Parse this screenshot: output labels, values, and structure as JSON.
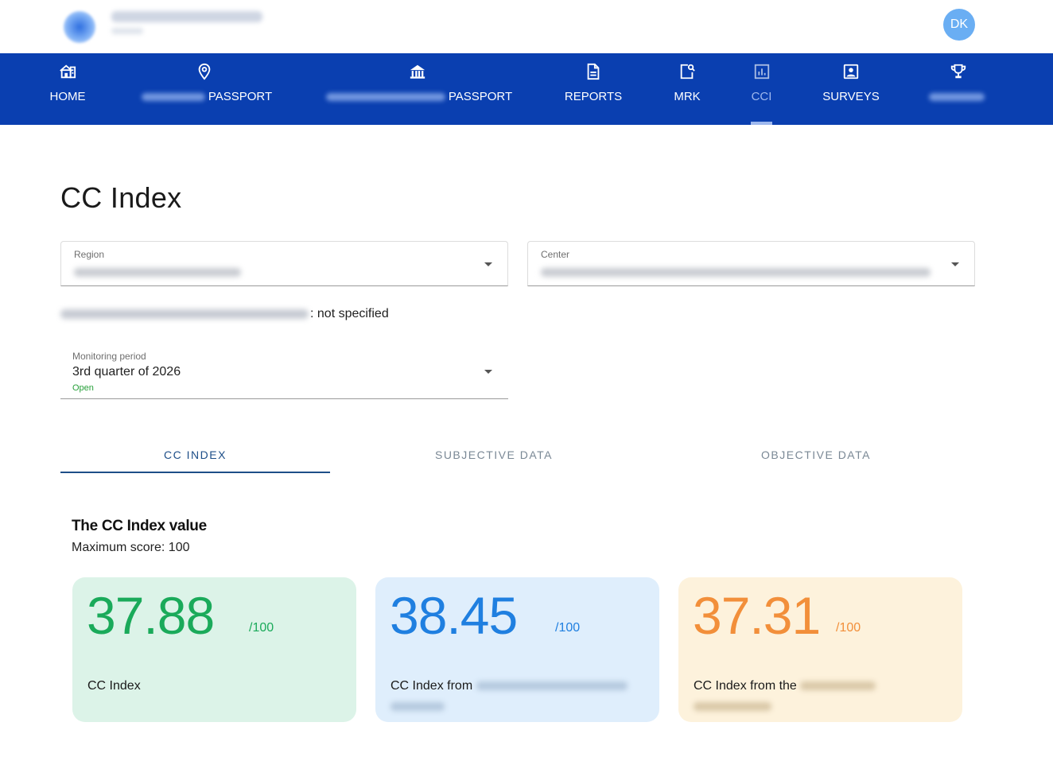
{
  "header": {
    "avatar_initials": "DK"
  },
  "nav": {
    "items": [
      {
        "label": "HOME",
        "icon": "home-building-icon"
      },
      {
        "label": "PASSPORT",
        "icon": "map-pin-icon"
      },
      {
        "label": "PASSPORT",
        "icon": "institution-icon"
      },
      {
        "label": "REPORTS",
        "icon": "document-icon"
      },
      {
        "label": "MRK",
        "icon": "document-search-icon"
      },
      {
        "label": "CCI",
        "icon": "bar-chart-icon",
        "active": true
      },
      {
        "label": "SURVEYS",
        "icon": "survey-person-icon"
      },
      {
        "label": "",
        "icon": "trophy-icon"
      }
    ],
    "active_color": "#9eb8ee",
    "background_color": "#0a3fb0"
  },
  "page": {
    "title": "CC Index"
  },
  "filters": {
    "region_label": "Region",
    "center_label": "Center",
    "wave_value": ": not specified",
    "period_label": "Monitoring period",
    "period_value": "3rd quarter of 2026",
    "period_status": "Open"
  },
  "tabs": [
    {
      "label": "CC INDEX",
      "active": true
    },
    {
      "label": "SUBJECTIVE DATA"
    },
    {
      "label": "OBJECTIVE DATA"
    }
  ],
  "summary": {
    "title": "The CC Index value",
    "subtitle": "Maximum score: 100"
  },
  "cards": [
    {
      "value": "37.88",
      "max": "/100",
      "caption": "CC Index",
      "color": "#1aaa5a",
      "bg": "#dcf3e8"
    },
    {
      "value": "38.45",
      "max": "/100",
      "caption": "CC Index from",
      "color": "#1f7fe0",
      "bg": "#dfeefc"
    },
    {
      "value": "37.31",
      "max": "/100",
      "caption": "CC Index from the",
      "color": "#f28f3a",
      "bg": "#fdf2dc"
    }
  ]
}
